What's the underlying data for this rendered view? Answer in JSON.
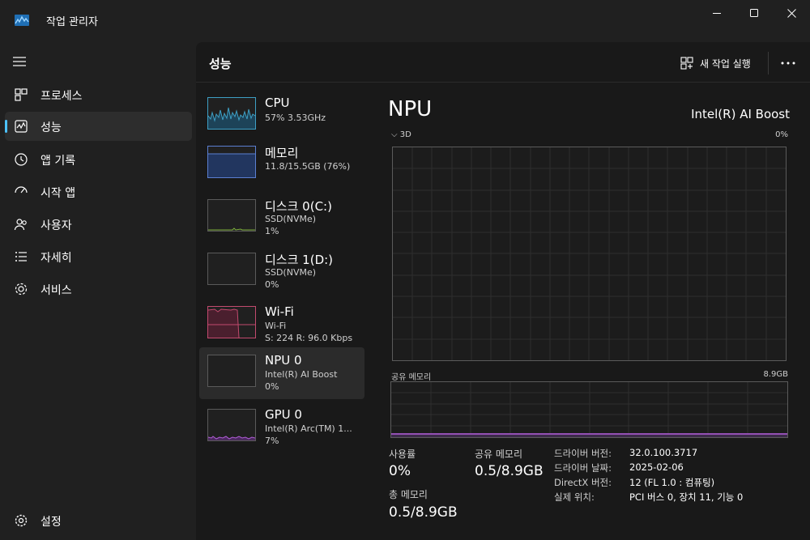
{
  "window": {
    "title": "작업 관리자",
    "controls": [
      "minimize",
      "maximize",
      "close"
    ]
  },
  "nav": {
    "items": [
      {
        "label": "프로세스",
        "icon": "processes-icon"
      },
      {
        "label": "성능",
        "icon": "performance-icon",
        "active": true
      },
      {
        "label": "앱 기록",
        "icon": "app-history-icon"
      },
      {
        "label": "시작 앱",
        "icon": "startup-apps-icon"
      },
      {
        "label": "사용자",
        "icon": "users-icon"
      },
      {
        "label": "자세히",
        "icon": "details-icon"
      },
      {
        "label": "서비스",
        "icon": "services-icon"
      }
    ],
    "settings_label": "설정"
  },
  "header": {
    "title": "성능",
    "run_task_label": "새 작업 실행"
  },
  "devices": [
    {
      "name": "CPU",
      "sub1": "57% 3.53GHz",
      "sub2": ""
    },
    {
      "name": "메모리",
      "sub1": "11.8/15.5GB (76%)",
      "sub2": ""
    },
    {
      "name": "디스크 0(C:)",
      "sub1": "SSD(NVMe)",
      "sub2": "1%"
    },
    {
      "name": "디스크 1(D:)",
      "sub1": "SSD(NVMe)",
      "sub2": "0%"
    },
    {
      "name": "Wi-Fi",
      "sub1": "Wi-Fi",
      "sub2": "S: 224  R: 96.0 Kbps"
    },
    {
      "name": "NPU 0",
      "sub1": "Intel(R) AI Boost",
      "sub2": "0%"
    },
    {
      "name": "GPU 0",
      "sub1": "Intel(R) Arc(TM) 1...",
      "sub2": "7%"
    }
  ],
  "detail": {
    "title": "NPU",
    "model": "Intel(R) AI Boost",
    "graph_3d_label": "3D",
    "graph_3d_max": "0%",
    "shared_mem_label": "공유 메모리",
    "shared_mem_max": "8.9GB",
    "stats": {
      "usage_label": "사용률",
      "usage_value": "0%",
      "shared_label": "공유 메모리",
      "shared_value": "0.5/8.9GB",
      "total_label": "총 메모리",
      "total_value": "0.5/8.9GB"
    },
    "info": [
      {
        "key": "드라이버 버전:",
        "value": "32.0.100.3717"
      },
      {
        "key": "드라이버 날짜:",
        "value": "2025-02-06"
      },
      {
        "key": "DirectX 버전:",
        "value": "12 (FL 1.0 : 컴퓨팅)"
      },
      {
        "key": "실제 위치:",
        "value": "PCI 버스 0, 장치 11, 기능 0"
      }
    ]
  },
  "colors": {
    "accent": "#4cc2ff",
    "cpu": "#3e9fc4",
    "memory": "#5b7fd1",
    "disk": "#7fb13d",
    "wifi": "#c24a6e",
    "gpu": "#b05cd6"
  }
}
